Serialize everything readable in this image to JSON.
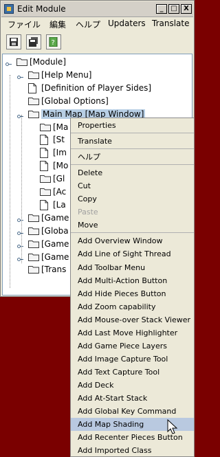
{
  "window": {
    "title": "Edit Module",
    "buttons": [
      "_",
      "□",
      "X"
    ]
  },
  "menubar": [
    "ファイル",
    "編集",
    "ヘルプ",
    "Updaters",
    "Translate"
  ],
  "toolbar": {
    "icons": [
      "save-icon",
      "save-as-icon",
      "help-icon"
    ]
  },
  "tree": {
    "nodes": [
      {
        "label": "[Module]",
        "icon": "folder-icon"
      },
      {
        "label": "[Help Menu]",
        "icon": "folder-icon"
      },
      {
        "label": "[Definition of Player Sides]",
        "icon": "document-icon"
      },
      {
        "label": "[Global Options]",
        "icon": "folder-icon"
      },
      {
        "label": "Main Map [Map Window]",
        "icon": "folder-icon",
        "selected": true
      },
      {
        "label": "[Ma",
        "icon": "folder-icon"
      },
      {
        "label": "[St",
        "icon": "document-icon"
      },
      {
        "label": "[Im",
        "icon": "document-icon"
      },
      {
        "label": "[Mo",
        "icon": "document-icon"
      },
      {
        "label": "[Gl",
        "icon": "folder-icon"
      },
      {
        "label": "[Ac",
        "icon": "folder-icon"
      },
      {
        "label": "[La",
        "icon": "document-icon"
      },
      {
        "label": "[Game",
        "icon": "folder-icon"
      },
      {
        "label": "[Globa",
        "icon": "folder-icon"
      },
      {
        "label": "[Game",
        "icon": "folder-icon"
      },
      {
        "label": "[Game",
        "icon": "folder-icon"
      },
      {
        "label": "[Trans",
        "icon": "folder-icon"
      }
    ]
  },
  "context_menu": {
    "items": [
      {
        "label": "Properties"
      },
      {
        "label": "Translate"
      },
      {
        "label": "ヘルプ"
      },
      {
        "label": "Delete"
      },
      {
        "label": "Cut"
      },
      {
        "label": "Copy"
      },
      {
        "label": "Paste",
        "disabled": true
      },
      {
        "label": "Move"
      },
      {
        "label": "Add Overview Window"
      },
      {
        "label": "Add Line of Sight Thread"
      },
      {
        "label": "Add Toolbar Menu"
      },
      {
        "label": "Add Multi-Action Button"
      },
      {
        "label": "Add Hide Pieces Button"
      },
      {
        "label": "Add Zoom capability"
      },
      {
        "label": "Add Mouse-over Stack Viewer"
      },
      {
        "label": "Add Last Move Highlighter"
      },
      {
        "label": "Add Game Piece Layers"
      },
      {
        "label": "Add Image Capture Tool"
      },
      {
        "label": "Add Text Capture Tool"
      },
      {
        "label": "Add Deck"
      },
      {
        "label": "Add At-Start Stack"
      },
      {
        "label": "Add Global Key Command"
      },
      {
        "label": "Add Map Shading",
        "highlighted": true
      },
      {
        "label": "Add Recenter Pieces Button"
      },
      {
        "label": "Add Imported Class"
      }
    ]
  },
  "colors": {
    "desktop": "#7a0000",
    "selection": "#b8cfe5",
    "menu_highlight": "#b9c9e0"
  }
}
